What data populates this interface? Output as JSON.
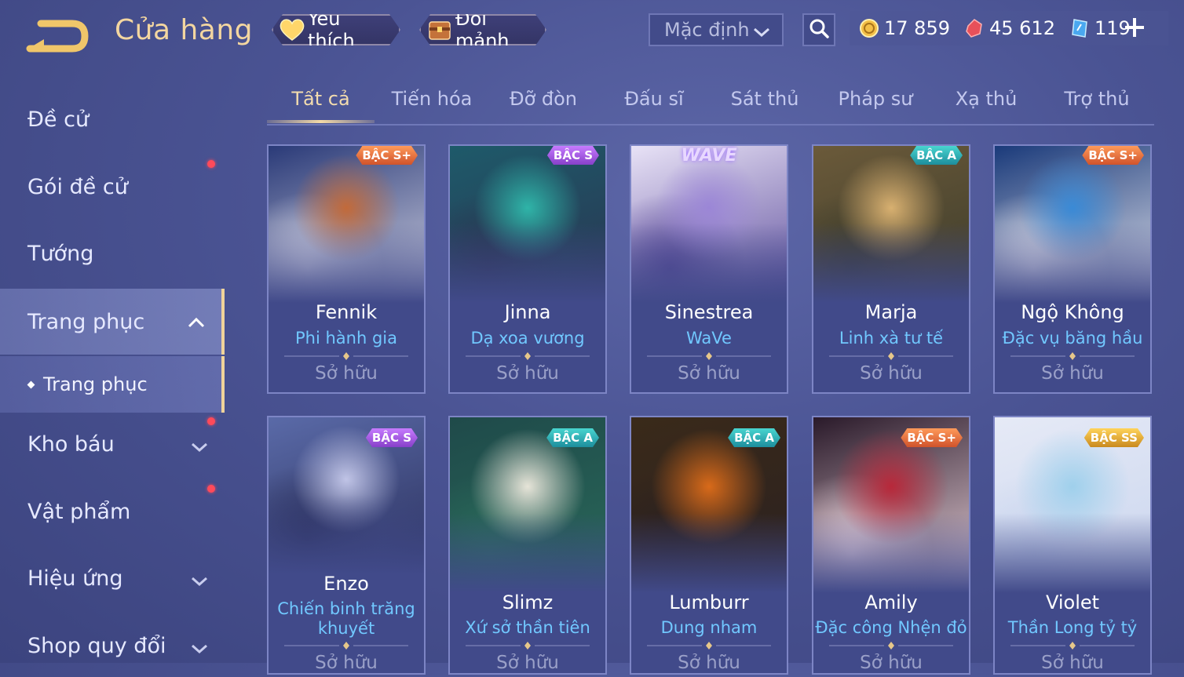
{
  "header": {
    "title": "Cửa hàng",
    "favorite_label": "Yêu thích",
    "shard_label": "Đổi mảnh",
    "sort_value": "Mặc định",
    "currencies": [
      {
        "icon": "gold-coin-icon",
        "value": "17 859",
        "color": "#f4c048"
      },
      {
        "icon": "red-gem-icon",
        "value": "45 612",
        "color": "#ff6b6b"
      },
      {
        "icon": "blue-voucher-icon",
        "value": "119",
        "color": "#6fc6ff"
      }
    ]
  },
  "sidebar": {
    "items": [
      {
        "label": "Đề cử"
      },
      {
        "label": "Gói đề cử"
      },
      {
        "label": "Tướng"
      },
      {
        "label": "Trang phục"
      },
      {
        "label": "Kho báu"
      },
      {
        "label": "Vật phẩm"
      },
      {
        "label": "Hiệu ứng"
      },
      {
        "label": "Shop quy đổi"
      }
    ],
    "sub_item": "Trang phục"
  },
  "tabs": [
    "Tất cả",
    "Tiến hóa",
    "Đỡ đòn",
    "Đấu sĩ",
    "Sát thủ",
    "Pháp sư",
    "Xạ thủ",
    "Trợ thủ"
  ],
  "cards": [
    {
      "name": "Fennik",
      "skin": "Phi hành gia",
      "status": "Sở hữu",
      "badge": "BẬC S+",
      "tier": "splus",
      "art_colors": [
        "#2a3a78",
        "#c26a3a",
        "#d8d8e6"
      ]
    },
    {
      "name": "Jinna",
      "skin": "Dạ xoa vương",
      "status": "Sở hữu",
      "badge": "BẬC S",
      "tier": "s",
      "art_colors": [
        "#1e5a6a",
        "#2fb4a8",
        "#2a3350"
      ]
    },
    {
      "name": "Sinestrea",
      "skin": "WaVe",
      "status": "Sở hữu",
      "badge": "WAVE",
      "tier": "none",
      "art_colors": [
        "#e8e2f6",
        "#9b86d6",
        "#5b4b9a"
      ]
    },
    {
      "name": "Marja",
      "skin": "Linh xà tư tế",
      "status": "Sở hữu",
      "badge": "BẬC A",
      "tier": "a",
      "art_colors": [
        "#6b5a3a",
        "#d8b070",
        "#3a3a2a"
      ]
    },
    {
      "name": "Ngộ Không",
      "skin": "Đặc vụ băng hầu",
      "status": "Sở hữu",
      "badge": "BẬC S+",
      "tier": "splus",
      "art_colors": [
        "#1a3a7a",
        "#3a8ad6",
        "#e8e8f0"
      ]
    },
    {
      "name": "Enzo",
      "skin": "Chiến binh trăng khuyết",
      "status": "Sở hữu",
      "badge": "BẬC S",
      "tier": "s",
      "art_colors": [
        "#5a6aa8",
        "#c0c4e6",
        "#2a2f5a"
      ]
    },
    {
      "name": "Slimz",
      "skin": "Xứ sở thần tiên",
      "status": "Sở hữu",
      "badge": "BẬC A",
      "tier": "a",
      "art_colors": [
        "#1f4a4a",
        "#e6e4d8",
        "#2a6a5a"
      ]
    },
    {
      "name": "Lumburr",
      "skin": "Dung nham",
      "status": "Sở hữu",
      "badge": "BẬC A",
      "tier": "a",
      "art_colors": [
        "#3a2a1a",
        "#d86a1a",
        "#2a2020"
      ]
    },
    {
      "name": "Amily",
      "skin": "Đặc công Nhện đỏ",
      "status": "Sở hữu",
      "badge": "BẬC S+",
      "tier": "splus",
      "art_colors": [
        "#2a1a2a",
        "#b8283a",
        "#f0d8e0"
      ]
    },
    {
      "name": "Violet",
      "skin": "Thần Long tỷ tỷ",
      "status": "Sở hữu",
      "badge": "BẬC SS",
      "tier": "ss",
      "art_colors": [
        "#e6eaf6",
        "#9fd0ec",
        "#c8d4ee"
      ]
    }
  ]
}
